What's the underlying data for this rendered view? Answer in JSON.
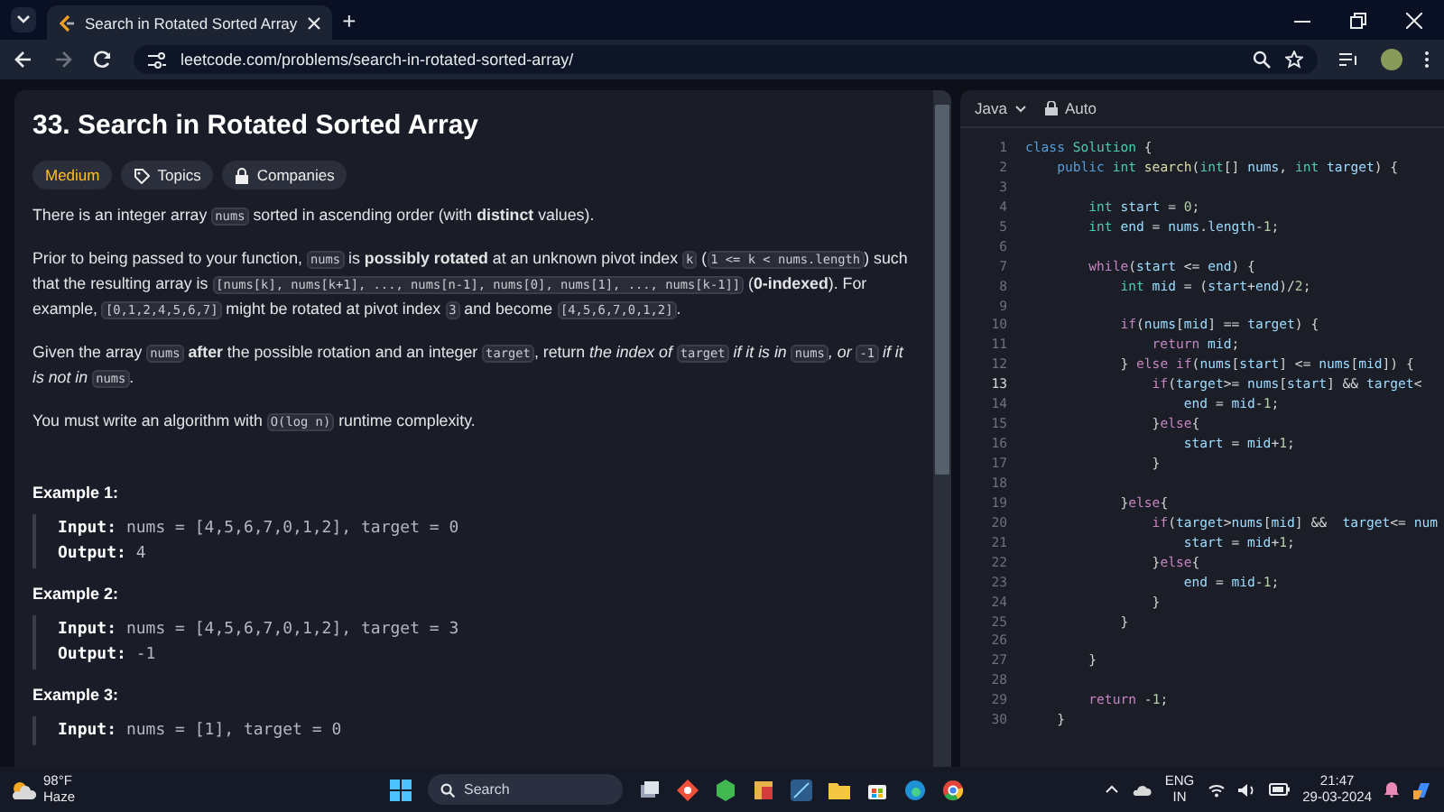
{
  "browser": {
    "tab": {
      "title": "Search in Rotated Sorted Array",
      "selected": true
    },
    "new_tab": "+",
    "address": "leetcode.com/problems/search-in-rotated-sorted-array/"
  },
  "problem": {
    "title": "33. Search in Rotated Sorted Array",
    "tags": [
      {
        "kind": "difficulty",
        "label": "Medium"
      },
      {
        "kind": "topics",
        "label": "Topics"
      },
      {
        "kind": "companies",
        "label": "Companies"
      }
    ],
    "paragraphs": [
      [
        {
          "kind": "text",
          "text": "There is an integer array "
        },
        {
          "kind": "code",
          "text": "nums"
        },
        {
          "kind": "text",
          "text": " sorted in ascending order (with **distinct** values)."
        }
      ],
      [
        {
          "kind": "text",
          "text": "Prior to being passed to your function, "
        },
        {
          "kind": "code",
          "text": "nums"
        },
        {
          "kind": "text",
          "text": " is **possibly rotated** at an unknown pivot index "
        },
        {
          "kind": "code",
          "text": "k"
        },
        {
          "kind": "text",
          "text": " ("
        },
        {
          "kind": "code",
          "text": "1 <= k < nums.length"
        },
        {
          "kind": "text",
          "text": ") such that the resulting array is "
        },
        {
          "kind": "code",
          "text": "[nums[k], nums[k+1], ..., nums[n-1], nums[0], nums[1], ..., nums[k-1]]"
        },
        {
          "kind": "text",
          "text": " (**0-indexed**). For example, "
        },
        {
          "kind": "code",
          "text": "[0,1,2,4,5,6,7]"
        },
        {
          "kind": "text",
          "text": " might be rotated at pivot index "
        },
        {
          "kind": "code",
          "text": "3"
        },
        {
          "kind": "text",
          "text": " and become "
        },
        {
          "kind": "code",
          "text": "[4,5,6,7,0,1,2]"
        },
        {
          "kind": "text",
          "text": "."
        }
      ],
      [
        {
          "kind": "text",
          "text": "Given the array "
        },
        {
          "kind": "code",
          "text": "nums"
        },
        {
          "kind": "text",
          "text": " **after** the possible rotation and an integer "
        },
        {
          "kind": "code",
          "text": "target"
        },
        {
          "kind": "text",
          "text": ", return *the index of* "
        },
        {
          "kind": "code",
          "text": "target"
        },
        {
          "kind": "text",
          "text": " *if it is in* "
        },
        {
          "kind": "code",
          "text": "nums"
        },
        {
          "kind": "text",
          "text": "*, or* "
        },
        {
          "kind": "code",
          "text": "-1"
        },
        {
          "kind": "text",
          "text": " *if it is not in* "
        },
        {
          "kind": "code",
          "text": "nums"
        },
        {
          "kind": "text",
          "text": "."
        }
      ],
      [
        {
          "kind": "text",
          "text": "You must write an algorithm with "
        },
        {
          "kind": "code",
          "text": "O(log n)"
        },
        {
          "kind": "text",
          "text": " runtime complexity."
        }
      ]
    ],
    "examples": [
      {
        "title": "Example 1:",
        "lines": [
          {
            "label": "Input:",
            "value": "nums = [4,5,6,7,0,1,2], target = 0"
          },
          {
            "label": "Output:",
            "value": "4"
          }
        ]
      },
      {
        "title": "Example 2:",
        "lines": [
          {
            "label": "Input:",
            "value": "nums = [4,5,6,7,0,1,2], target = 3"
          },
          {
            "label": "Output:",
            "value": "-1"
          }
        ]
      },
      {
        "title": "Example 3:",
        "lines": [
          {
            "label": "Input:",
            "value": "nums = [1], target = 0"
          }
        ]
      }
    ]
  },
  "editor": {
    "language": "Java",
    "mode": "Auto",
    "lines": [
      {
        "number": "1",
        "active": false,
        "tokens": [
          {
            "kind": "keyword",
            "text": "class"
          },
          {
            "kind": "type",
            "text": " Solution"
          },
          {
            "kind": "plain",
            "text": " {"
          }
        ]
      },
      {
        "number": "2",
        "active": false,
        "tokens": [
          {
            "kind": "keyword",
            "text": "    public"
          },
          {
            "kind": "type",
            "text": " int"
          },
          {
            "kind": "function",
            "text": " search"
          },
          {
            "kind": "plain",
            "text": "("
          },
          {
            "kind": "type",
            "text": "int"
          },
          {
            "kind": "plain",
            "text": "[]"
          },
          {
            "kind": "variable",
            "text": " nums"
          },
          {
            "kind": "plain",
            "text": ","
          },
          {
            "kind": "type",
            "text": " int"
          },
          {
            "kind": "variable",
            "text": " target"
          },
          {
            "kind": "plain",
            "text": ") {"
          }
        ]
      },
      {
        "number": "3",
        "active": false
      },
      {
        "number": "4",
        "active": false,
        "tokens": [
          {
            "kind": "type",
            "text": "        int"
          },
          {
            "kind": "variable",
            "text": " start"
          },
          {
            "kind": "plain",
            "text": " = "
          },
          {
            "kind": "number",
            "text": "0"
          },
          {
            "kind": "plain",
            "text": ";"
          }
        ]
      },
      {
        "number": "5",
        "active": false,
        "tokens": [
          {
            "kind": "type",
            "text": "        int"
          },
          {
            "kind": "variable",
            "text": " end"
          },
          {
            "kind": "plain",
            "text": " = "
          },
          {
            "kind": "variable",
            "text": "nums"
          },
          {
            "kind": "plain",
            "text": "."
          },
          {
            "kind": "variable",
            "text": "length"
          },
          {
            "kind": "plain",
            "text": "-"
          },
          {
            "kind": "number",
            "text": "1"
          },
          {
            "kind": "plain",
            "text": ";"
          }
        ]
      },
      {
        "number": "6",
        "active": false
      },
      {
        "number": "7",
        "active": false,
        "tokens": [
          {
            "kind": "control",
            "text": "        while"
          },
          {
            "kind": "plain",
            "text": "("
          },
          {
            "kind": "variable",
            "text": "start"
          },
          {
            "kind": "plain",
            "text": " <= "
          },
          {
            "kind": "variable",
            "text": "end"
          },
          {
            "kind": "plain",
            "text": ") {"
          }
        ]
      },
      {
        "number": "8",
        "active": false,
        "tokens": [
          {
            "kind": "type",
            "text": "            int"
          },
          {
            "kind": "variable",
            "text": " mid"
          },
          {
            "kind": "plain",
            "text": " = ("
          },
          {
            "kind": "variable",
            "text": "start"
          },
          {
            "kind": "plain",
            "text": "+"
          },
          {
            "kind": "variable",
            "text": "end"
          },
          {
            "kind": "plain",
            "text": ")/"
          },
          {
            "kind": "number",
            "text": "2"
          },
          {
            "kind": "plain",
            "text": ";"
          }
        ]
      },
      {
        "number": "9",
        "active": false
      },
      {
        "number": "10",
        "active": false,
        "tokens": [
          {
            "kind": "control",
            "text": "            if"
          },
          {
            "kind": "plain",
            "text": "("
          },
          {
            "kind": "variable",
            "text": "nums"
          },
          {
            "kind": "plain",
            "text": "["
          },
          {
            "kind": "variable",
            "text": "mid"
          },
          {
            "kind": "plain",
            "text": "] == "
          },
          {
            "kind": "variable",
            "text": "target"
          },
          {
            "kind": "plain",
            "text": ") {"
          }
        ]
      },
      {
        "number": "11",
        "active": false,
        "tokens": [
          {
            "kind": "control",
            "text": "                return"
          },
          {
            "kind": "variable",
            "text": " mid"
          },
          {
            "kind": "plain",
            "text": ";"
          }
        ]
      },
      {
        "number": "12",
        "active": false,
        "tokens": [
          {
            "kind": "plain",
            "text": "            } "
          },
          {
            "kind": "control",
            "text": "else"
          },
          {
            "kind": "control",
            "text": " if"
          },
          {
            "kind": "plain",
            "text": "("
          },
          {
            "kind": "variable",
            "text": "nums"
          },
          {
            "kind": "plain",
            "text": "["
          },
          {
            "kind": "variable",
            "text": "start"
          },
          {
            "kind": "plain",
            "text": "] <= "
          },
          {
            "kind": "variable",
            "text": "nums"
          },
          {
            "kind": "plain",
            "text": "["
          },
          {
            "kind": "variable",
            "text": "mid"
          },
          {
            "kind": "plain",
            "text": "]) {"
          }
        ]
      },
      {
        "number": "13",
        "active": true,
        "tokens": [
          {
            "kind": "control",
            "text": "                if"
          },
          {
            "kind": "plain",
            "text": "("
          },
          {
            "kind": "variable",
            "text": "target"
          },
          {
            "kind": "plain",
            "text": ">= "
          },
          {
            "kind": "variable",
            "text": "nums"
          },
          {
            "kind": "plain",
            "text": "["
          },
          {
            "kind": "variable",
            "text": "start"
          },
          {
            "kind": "plain",
            "text": "] && "
          },
          {
            "kind": "variable",
            "text": "target"
          },
          {
            "kind": "plain",
            "text": "<"
          }
        ]
      },
      {
        "number": "14",
        "active": false,
        "tokens": [
          {
            "kind": "variable",
            "text": "                    end"
          },
          {
            "kind": "plain",
            "text": " = "
          },
          {
            "kind": "variable",
            "text": "mid"
          },
          {
            "kind": "plain",
            "text": "-"
          },
          {
            "kind": "number",
            "text": "1"
          },
          {
            "kind": "plain",
            "text": ";"
          }
        ]
      },
      {
        "number": "15",
        "active": false,
        "tokens": [
          {
            "kind": "plain",
            "text": "                }"
          },
          {
            "kind": "control",
            "text": "else"
          },
          {
            "kind": "plain",
            "text": "{"
          }
        ]
      },
      {
        "number": "16",
        "active": false,
        "tokens": [
          {
            "kind": "variable",
            "text": "                    start"
          },
          {
            "kind": "plain",
            "text": " = "
          },
          {
            "kind": "variable",
            "text": "mid"
          },
          {
            "kind": "plain",
            "text": "+"
          },
          {
            "kind": "number",
            "text": "1"
          },
          {
            "kind": "plain",
            "text": ";"
          }
        ]
      },
      {
        "number": "17",
        "active": false,
        "tokens": [
          {
            "kind": "plain",
            "text": "                }"
          }
        ]
      },
      {
        "number": "18",
        "active": false
      },
      {
        "number": "19",
        "active": false,
        "tokens": [
          {
            "kind": "plain",
            "text": "            }"
          },
          {
            "kind": "control",
            "text": "else"
          },
          {
            "kind": "plain",
            "text": "{"
          }
        ]
      },
      {
        "number": "20",
        "active": false,
        "tokens": [
          {
            "kind": "control",
            "text": "                if"
          },
          {
            "kind": "plain",
            "text": "("
          },
          {
            "kind": "variable",
            "text": "target"
          },
          {
            "kind": "plain",
            "text": ">"
          },
          {
            "kind": "variable",
            "text": "nums"
          },
          {
            "kind": "plain",
            "text": "["
          },
          {
            "kind": "variable",
            "text": "mid"
          },
          {
            "kind": "plain",
            "text": "] &&  "
          },
          {
            "kind": "variable",
            "text": "target"
          },
          {
            "kind": "plain",
            "text": "<= "
          },
          {
            "kind": "variable",
            "text": "num"
          }
        ]
      },
      {
        "number": "21",
        "active": false,
        "tokens": [
          {
            "kind": "variable",
            "text": "                    start"
          },
          {
            "kind": "plain",
            "text": " = "
          },
          {
            "kind": "variable",
            "text": "mid"
          },
          {
            "kind": "plain",
            "text": "+"
          },
          {
            "kind": "number",
            "text": "1"
          },
          {
            "kind": "plain",
            "text": ";"
          }
        ]
      },
      {
        "number": "22",
        "active": false,
        "tokens": [
          {
            "kind": "plain",
            "text": "                }"
          },
          {
            "kind": "control",
            "text": "else"
          },
          {
            "kind": "plain",
            "text": "{"
          }
        ]
      },
      {
        "number": "23",
        "active": false,
        "tokens": [
          {
            "kind": "variable",
            "text": "                    end"
          },
          {
            "kind": "plain",
            "text": " = "
          },
          {
            "kind": "variable",
            "text": "mid"
          },
          {
            "kind": "plain",
            "text": "-"
          },
          {
            "kind": "number",
            "text": "1"
          },
          {
            "kind": "plain",
            "text": ";"
          }
        ]
      },
      {
        "number": "24",
        "active": false,
        "tokens": [
          {
            "kind": "plain",
            "text": "                }"
          }
        ]
      },
      {
        "number": "25",
        "active": false,
        "tokens": [
          {
            "kind": "plain",
            "text": "            }"
          }
        ]
      },
      {
        "number": "26",
        "active": false
      },
      {
        "number": "27",
        "active": false,
        "tokens": [
          {
            "kind": "plain",
            "text": "        }"
          }
        ]
      },
      {
        "number": "28",
        "active": false
      },
      {
        "number": "29",
        "active": false,
        "tokens": [
          {
            "kind": "control",
            "text": "        return"
          },
          {
            "kind": "plain",
            "text": " -"
          },
          {
            "kind": "number",
            "text": "1"
          },
          {
            "kind": "plain",
            "text": ";"
          }
        ]
      },
      {
        "number": "30",
        "active": false,
        "tokens": [
          {
            "kind": "plain",
            "text": "    }"
          }
        ]
      }
    ]
  },
  "taskbar": {
    "weather": {
      "temperature": "98°F",
      "condition": "Haze"
    },
    "search": {
      "placeholder": "Search"
    },
    "language": {
      "code": "ENG",
      "region": "IN"
    },
    "clock": {
      "time": "21:47",
      "date": "29-03-2024"
    }
  }
}
